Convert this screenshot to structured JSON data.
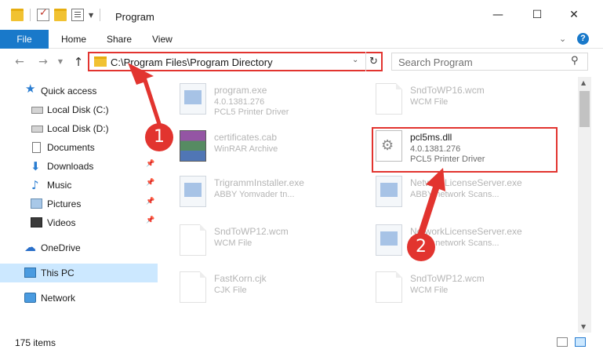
{
  "window": {
    "title": "Program",
    "minimize": "—",
    "maximize": "☐",
    "close": "✕"
  },
  "ribbon": {
    "tabs": [
      "File",
      "Home",
      "Share",
      "View"
    ],
    "help": "?"
  },
  "address": {
    "path": "C:\\Program Files\\Program Directory",
    "search_placeholder": "Search Program"
  },
  "sidebar": {
    "items": [
      {
        "label": "Quick access"
      },
      {
        "label": "Local Disk (C:)"
      },
      {
        "label": "Local Disk (D:)"
      },
      {
        "label": "Documents"
      },
      {
        "label": "Downloads"
      },
      {
        "label": "Music"
      },
      {
        "label": "Pictures"
      },
      {
        "label": "Videos"
      },
      {
        "label": "OneDrive"
      },
      {
        "label": "This PC"
      },
      {
        "label": "Network"
      }
    ]
  },
  "files": [
    {
      "name": "program.exe",
      "line2": "4.0.1381.276",
      "line3": "PCL5 Printer Driver"
    },
    {
      "name": "SndToWP16.wcm",
      "line2": "WCM File",
      "line3": ""
    },
    {
      "name": "certificates.cab",
      "line2": "WinRAR Archive",
      "line3": ""
    },
    {
      "name": "pcl5ms.dll",
      "line2": "4.0.1381.276",
      "line3": "PCL5 Printer Driver"
    },
    {
      "name": "TrigrammInstaller.exe",
      "line2": "ABBY Yomvader tn...",
      "line3": ""
    },
    {
      "name": "NetworkLicenseServer.exe",
      "line2": "ABBY network Scans...",
      "line3": ""
    },
    {
      "name": "SndToWP12.wcm",
      "line2": "WCM File",
      "line3": ""
    },
    {
      "name": "NetworkLicenseServer.exe",
      "line2": "ABBY network Scans...",
      "line3": ""
    },
    {
      "name": "FastKorn.cjk",
      "line2": "CJK File",
      "line3": ""
    },
    {
      "name": "SndToWP12.wcm",
      "line2": "WCM File",
      "line3": ""
    }
  ],
  "status": {
    "count": "175 items"
  },
  "callouts": {
    "one": "1",
    "two": "2"
  },
  "colors": {
    "accent": "#1979ca",
    "highlight": "#e2342f",
    "selected": "#cce8ff"
  }
}
